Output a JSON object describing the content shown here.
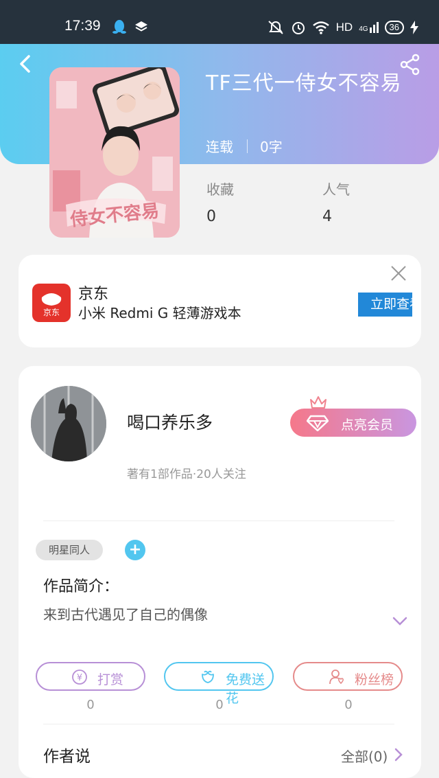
{
  "status_bar": {
    "time": "17:39",
    "network": "HD",
    "signal_label": "4G",
    "battery": "36"
  },
  "book": {
    "title": "TF三代一侍女不容易",
    "status": "连载",
    "word_count": "0字",
    "stats": [
      {
        "label": "收藏",
        "value": "0"
      },
      {
        "label": "人气",
        "value": "4"
      }
    ]
  },
  "ad": {
    "brand": "京东",
    "logo_text": "京东",
    "description": "小米 Redmi G 轻薄游戏本",
    "cta": "立即查看"
  },
  "author": {
    "name": "喝口养乐多",
    "meta": "著有1部作品·20人关注",
    "vip_label": "点亮会员"
  },
  "tags": [
    "明星同人"
  ],
  "tag_add": "+",
  "intro": {
    "label": "作品简介：",
    "text": "来到古代遇见了自己的偶像"
  },
  "actions": [
    {
      "label": "打赏",
      "count": "0",
      "color": "#b78fd6",
      "icon": "yuan-coin-icon"
    },
    {
      "label": "免费送花",
      "count": "0",
      "color": "#52c6ef",
      "icon": "flower-icon"
    },
    {
      "label": "粉丝榜",
      "count": "0",
      "color": "#e58a8a",
      "icon": "fan-ranking-icon"
    }
  ],
  "author_says": {
    "label": "作者说",
    "all_link": "全部(0)"
  },
  "colors": {
    "header_start": "#5bcdf0",
    "header_end": "#b99de6",
    "vip_start": "#f5788a",
    "vip_end": "#c996e0",
    "ad_button": "#2288d8"
  }
}
